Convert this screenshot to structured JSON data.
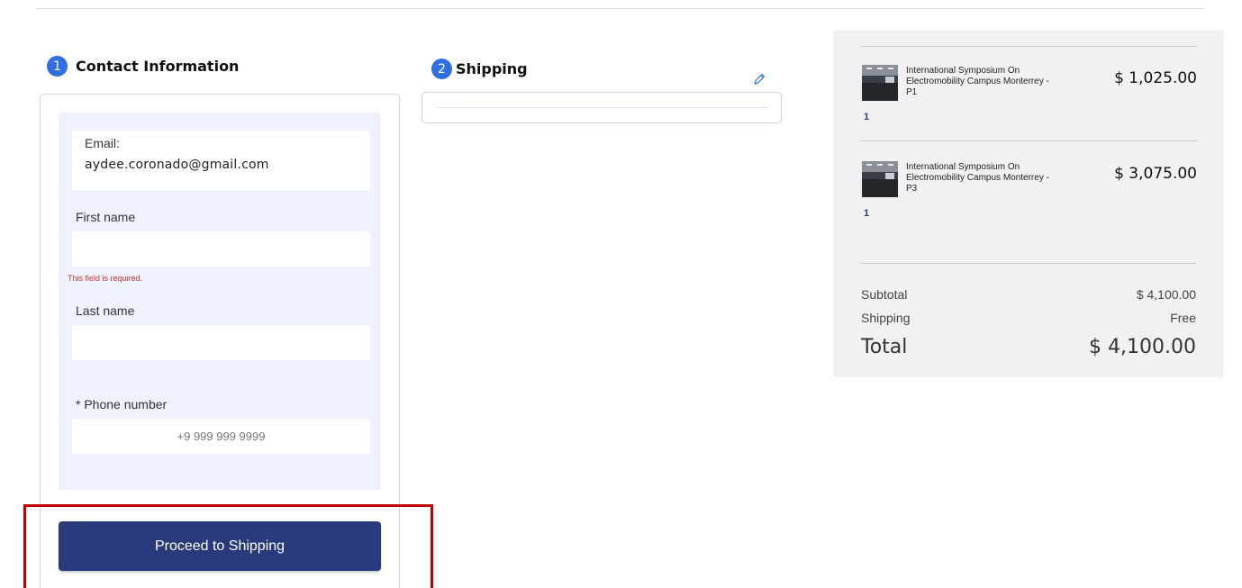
{
  "steps": {
    "contact": {
      "number": "1",
      "title": "Contact Information"
    },
    "shipping": {
      "number": "2",
      "title": "Shipping"
    }
  },
  "contact_form": {
    "email_label": "Email:",
    "email_value": "aydee.coronado@gmail.com",
    "first_name_label": "First name",
    "first_name_value": "",
    "first_name_error": "This field is required.",
    "last_name_label": "Last name",
    "last_name_value": "",
    "phone_label": "* Phone number",
    "phone_placeholder": "+9 999 999 9999",
    "proceed_label": "Proceed to Shipping"
  },
  "summary": {
    "items": [
      {
        "name": "International Symposium On Electromobility Campus Monterrey - P1",
        "qty": "1",
        "price": "$ 1,025.00"
      },
      {
        "name": "International Symposium On Electromobility Campus Monterrey - P3",
        "qty": "1",
        "price": "$ 3,075.00"
      }
    ],
    "subtotal_label": "Subtotal",
    "subtotal_value": "$ 4,100.00",
    "shipping_label": "Shipping",
    "shipping_value": "Free",
    "total_label": "Total",
    "total_value": "$ 4,100.00"
  },
  "icons": {
    "edit": "pencil-icon"
  },
  "colors": {
    "step_badge": "#2f6fe0",
    "primary_button": "#283a7c",
    "error": "#d0312d",
    "highlight": "#c00000",
    "form_panel": "#eef2fc",
    "summary_bg": "#f1f1f1"
  }
}
